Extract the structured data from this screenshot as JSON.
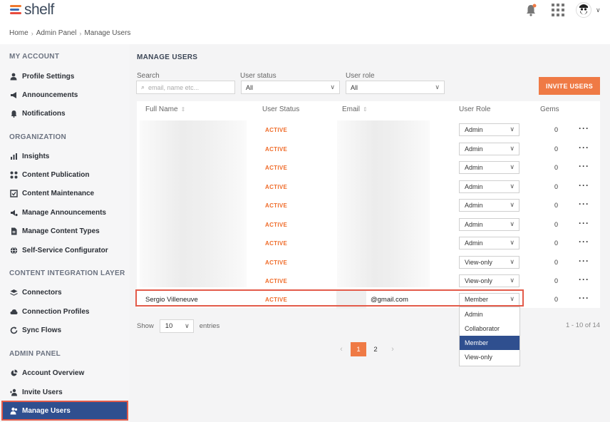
{
  "app": {
    "logo_text": "shelf"
  },
  "breadcrumb": [
    "Home",
    "Admin Panel",
    "Manage Users"
  ],
  "sidebar": {
    "sections": [
      {
        "title": "MY ACCOUNT",
        "items": [
          {
            "label": "Profile Settings",
            "icon": "user-gear-icon"
          },
          {
            "label": "Announcements",
            "icon": "megaphone-icon"
          },
          {
            "label": "Notifications",
            "icon": "bell-icon"
          }
        ]
      },
      {
        "title": "ORGANIZATION",
        "items": [
          {
            "label": "Insights",
            "icon": "bar-chart-icon"
          },
          {
            "label": "Content Publication",
            "icon": "nodes-icon"
          },
          {
            "label": "Content Maintenance",
            "icon": "checklist-icon"
          },
          {
            "label": "Manage Announcements",
            "icon": "megaphone-gear-icon"
          },
          {
            "label": "Manage Content Types",
            "icon": "document-icon"
          },
          {
            "label": "Self-Service Configurator",
            "icon": "globe-icon"
          }
        ]
      },
      {
        "title": "CONTENT INTEGRATION LAYER",
        "items": [
          {
            "label": "Connectors",
            "icon": "layers-icon"
          },
          {
            "label": "Connection Profiles",
            "icon": "cloud-icon"
          },
          {
            "label": "Sync Flows",
            "icon": "sync-icon"
          }
        ]
      },
      {
        "title": "ADMIN PANEL",
        "items": [
          {
            "label": "Account Overview",
            "icon": "pie-chart-icon"
          },
          {
            "label": "Invite Users",
            "icon": "invite-icon"
          },
          {
            "label": "Manage Users",
            "icon": "users-icon",
            "active": true
          }
        ]
      }
    ]
  },
  "main": {
    "title": "MANAGE USERS",
    "filters": {
      "search_label": "Search",
      "search_placeholder": "email, name etc...",
      "status_label": "User status",
      "status_value": "All",
      "role_label": "User role",
      "role_value": "All"
    },
    "invite_button": "INVITE USERS",
    "table": {
      "headers": [
        "Full Name",
        "User Status",
        "Email",
        "User Role",
        "Gems"
      ],
      "rows": [
        {
          "name": "",
          "status": "ACTIVE",
          "email": "",
          "role": "Admin",
          "gems": "0"
        },
        {
          "name": "",
          "status": "ACTIVE",
          "email": "",
          "role": "Admin",
          "gems": "0"
        },
        {
          "name": "",
          "status": "ACTIVE",
          "email": "",
          "role": "Admin",
          "gems": "0"
        },
        {
          "name": "",
          "status": "ACTIVE",
          "email": "",
          "role": "Admin",
          "gems": "0"
        },
        {
          "name": "",
          "status": "ACTIVE",
          "email": "",
          "role": "Admin",
          "gems": "0"
        },
        {
          "name": "",
          "status": "ACTIVE",
          "email": "",
          "role": "Admin",
          "gems": "0"
        },
        {
          "name": "",
          "status": "ACTIVE",
          "email": "",
          "role": "Admin",
          "gems": "0"
        },
        {
          "name": "",
          "status": "ACTIVE",
          "email": "",
          "role": "View-only",
          "gems": "0"
        },
        {
          "name": "",
          "status": "ACTIVE",
          "email": "",
          "role": "View-only",
          "gems": "0"
        },
        {
          "name": "Sergio Villeneuve",
          "status": "ACTIVE",
          "email": "@gmail.com",
          "role": "Member",
          "gems": "0"
        }
      ]
    },
    "role_dropdown": {
      "options": [
        "Admin",
        "Collaborator",
        "Member",
        "View-only"
      ],
      "selected": "Member"
    },
    "show": {
      "label": "Show",
      "value": "10",
      "suffix": "entries"
    },
    "range": "1 - 10 of 14",
    "pagination": {
      "pages": [
        "1",
        "2"
      ],
      "current": "1",
      "prev": "‹",
      "next": "›"
    }
  },
  "colors": {
    "accent": "#ef7a45",
    "active_nav": "#2f4f8f",
    "highlight": "#e35b4a"
  }
}
